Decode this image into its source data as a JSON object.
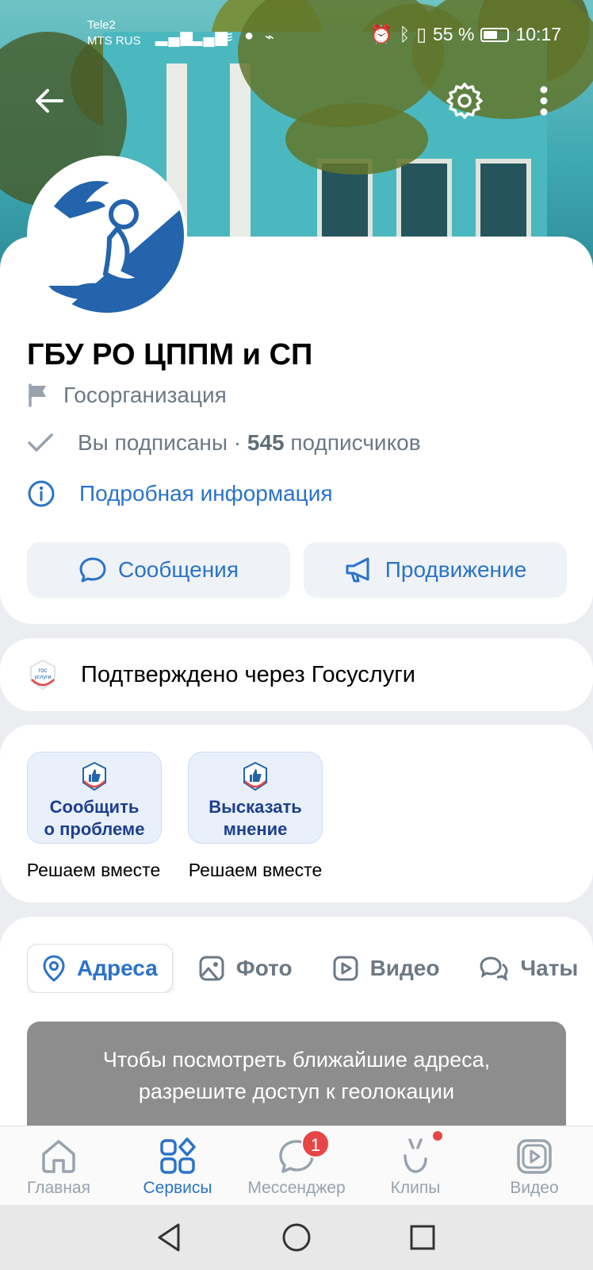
{
  "status_bar": {
    "carrier1": "Tele2",
    "carrier2": "MTS RUS",
    "battery": "55 %",
    "time": "10:17"
  },
  "group": {
    "name": "ГБУ РО ЦППМ и СП",
    "type": "Госорганизация",
    "subscribed": "Вы подписаны · ",
    "subscribers_count": "545",
    "subscribers_label": " подписчиков",
    "details_link": "Подробная информация"
  },
  "actions": {
    "messages": "Сообщения",
    "promotion": "Продвижение"
  },
  "verification": {
    "text": "Подтверждено через Госуслуги",
    "logo_line1": "гос",
    "logo_line2": "услуги"
  },
  "widgets": [
    {
      "label_line1": "Сообщить",
      "label_line2": "о проблеме",
      "caption": "Решаем вместе"
    },
    {
      "label_line1": "Высказать",
      "label_line2": "мнение",
      "caption": "Решаем вместе"
    }
  ],
  "tabs": [
    {
      "label": "Адреса",
      "icon": "location-pin-icon",
      "active": true
    },
    {
      "label": "Фото",
      "icon": "photo-icon",
      "active": false
    },
    {
      "label": "Видео",
      "icon": "video-icon",
      "active": false
    },
    {
      "label": "Чаты",
      "icon": "chat-icon",
      "active": false
    }
  ],
  "geo_prompt": {
    "line1": "Чтобы посмотреть ближайшие адреса,",
    "line2": "разрешите доступ к геолокации"
  },
  "bottom_nav": [
    {
      "label": "Главная",
      "icon": "home-icon",
      "active": false
    },
    {
      "label": "Сервисы",
      "icon": "services-icon",
      "active": true
    },
    {
      "label": "Мессенджер",
      "icon": "messenger-icon",
      "active": false,
      "badge": "1"
    },
    {
      "label": "Клипы",
      "icon": "clips-icon",
      "active": false
    },
    {
      "label": "Видео",
      "icon": "video-icon",
      "active": false
    }
  ],
  "colors": {
    "accent": "#2a73c9",
    "secondary_text": "#6d7885",
    "badge": "#e64646"
  }
}
